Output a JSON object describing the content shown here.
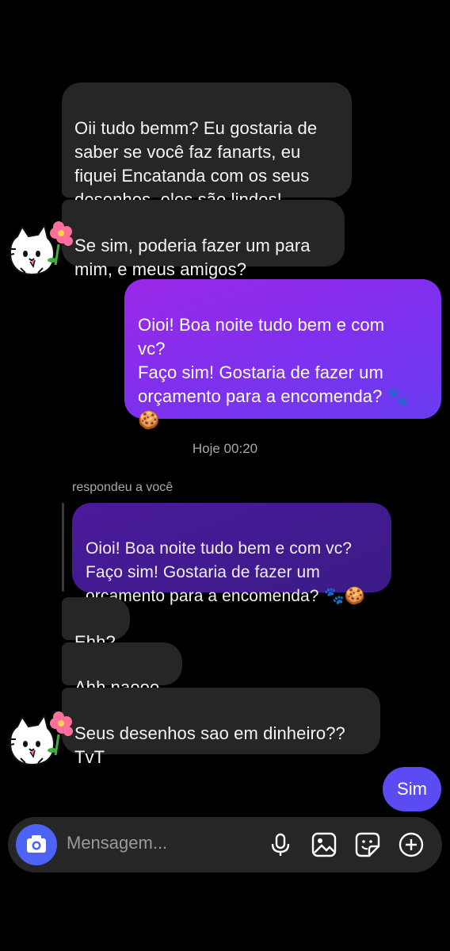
{
  "messages": [
    {
      "id": "m1",
      "direction": "in",
      "text": "Oii tudo bemm? Eu gostaria de\nsaber se você faz fanarts, eu\nfiquei Encatanda com os seus\ndesenhos, eles são lindos!"
    },
    {
      "id": "m2",
      "direction": "in",
      "text": "Se sim, poderia fazer um para\nmim, e meus amigos?"
    },
    {
      "id": "m3",
      "direction": "out",
      "text": "Oioi! Boa noite tudo bem e com\nvc?\nFaço sim! Gostaria de fazer um\norçamento para a encomenda? 🐾\n🍪"
    },
    {
      "id": "m4",
      "direction": "in",
      "text": "Ehh?"
    },
    {
      "id": "m5",
      "direction": "in",
      "text": "Ahh naooo"
    },
    {
      "id": "m6",
      "direction": "in",
      "text": "Seus desenhos sao em dinheiro??\nTvT"
    },
    {
      "id": "m7",
      "direction": "out",
      "text": "Sim"
    }
  ],
  "timestamp": "Hoje 00:20",
  "reply": {
    "label": "respondeu a você",
    "quoted_text": "Oioi! Boa noite tudo bem e com vc?\nFaço sim! Gostaria de fazer um\norçamento para a encomenda? 🐾🍪"
  },
  "composer": {
    "placeholder": "Mensagem...",
    "icons": [
      "camera-icon",
      "microphone-icon",
      "gallery-icon",
      "sticker-icon",
      "plus-icon"
    ]
  },
  "colors": {
    "outgoing_gradient": [
      "#9b28e8",
      "#6a3cf0"
    ],
    "incoming": "#262626",
    "camera_button": "#4d63f5",
    "last_outgoing": "#5a4cf2"
  }
}
